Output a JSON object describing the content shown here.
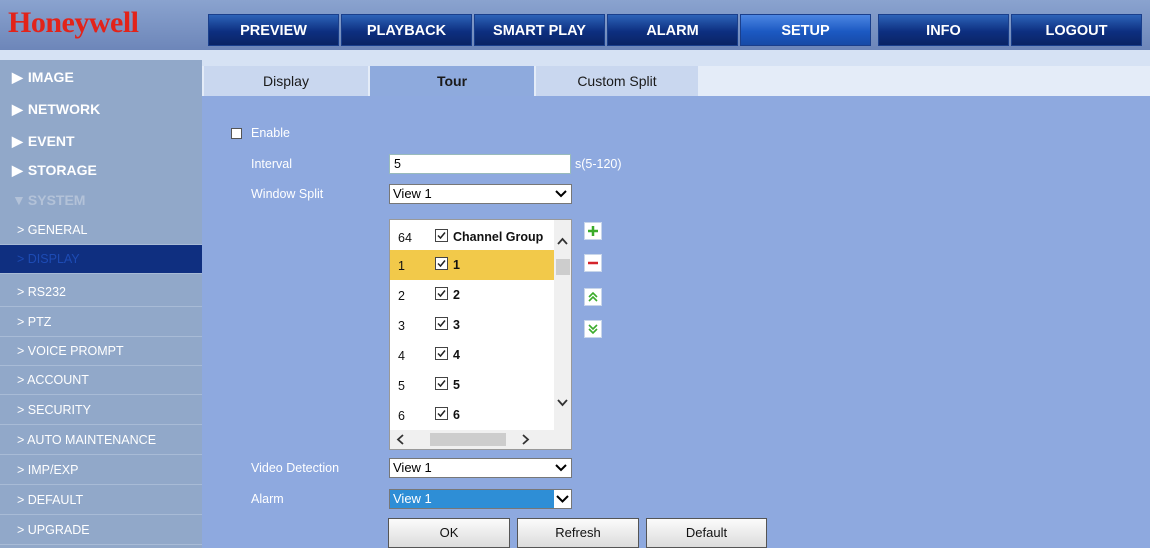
{
  "brand": {
    "logo_text": "Honeywell",
    "logo_color": "#e2231a"
  },
  "nav": {
    "items": [
      {
        "label": "PREVIEW"
      },
      {
        "label": "PLAYBACK"
      },
      {
        "label": "SMART PLAY"
      },
      {
        "label": "ALARM"
      },
      {
        "label": "SETUP",
        "active": true
      },
      {
        "label": "INFO"
      },
      {
        "label": "LOGOUT"
      }
    ]
  },
  "sidebar": {
    "categories": [
      {
        "label": "IMAGE",
        "expanded": false
      },
      {
        "label": "NETWORK",
        "expanded": false
      },
      {
        "label": "EVENT",
        "expanded": false
      },
      {
        "label": "STORAGE",
        "expanded": false
      },
      {
        "label": "SYSTEM",
        "expanded": true
      }
    ],
    "system_items": [
      {
        "label": "> GENERAL"
      },
      {
        "label": "> DISPLAY",
        "selected": true
      },
      {
        "label": "> RS232"
      },
      {
        "label": "> PTZ"
      },
      {
        "label": "> VOICE PROMPT"
      },
      {
        "label": "> ACCOUNT"
      },
      {
        "label": "> SECURITY"
      },
      {
        "label": "> AUTO MAINTENANCE"
      },
      {
        "label": "> IMP/EXP"
      },
      {
        "label": "> DEFAULT"
      },
      {
        "label": "> UPGRADE"
      }
    ]
  },
  "tabs": [
    {
      "label": "Display"
    },
    {
      "label": "Tour",
      "active": true
    },
    {
      "label": "Custom Split"
    }
  ],
  "form": {
    "enable_label": "Enable",
    "enable_checked": false,
    "interval_label": "Interval",
    "interval_value": "5",
    "interval_hint": "s(5-120)",
    "window_split_label": "Window Split",
    "window_split_value": "View 1",
    "video_detection_label": "Video Detection",
    "video_detection_value": "View 1",
    "alarm_label": "Alarm",
    "alarm_value": "View 1"
  },
  "channel_list": {
    "rows": [
      {
        "num": "64",
        "name": "Channel Group",
        "checked": true
      },
      {
        "num": "1",
        "name": "1",
        "checked": true,
        "selected": true
      },
      {
        "num": "2",
        "name": "2",
        "checked": true
      },
      {
        "num": "3",
        "name": "3",
        "checked": true
      },
      {
        "num": "4",
        "name": "4",
        "checked": true
      },
      {
        "num": "5",
        "name": "5",
        "checked": true
      },
      {
        "num": "6",
        "name": "6",
        "checked": true
      }
    ],
    "side_buttons": [
      "add-icon",
      "remove-icon",
      "move-up-icon",
      "move-down-icon"
    ]
  },
  "buttons": {
    "ok": "OK",
    "refresh": "Refresh",
    "default": "Default"
  }
}
